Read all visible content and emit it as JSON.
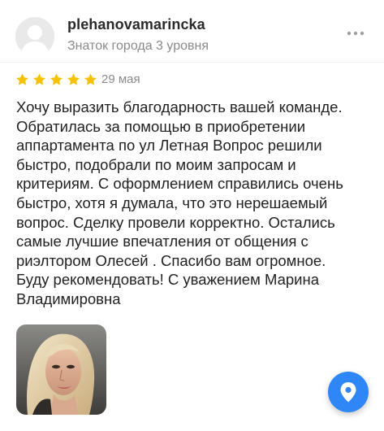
{
  "user": {
    "name": "plehanovamarincka",
    "level": "Знаток города 3 уровня",
    "avatar_icon": "user-avatar-placeholder"
  },
  "review": {
    "rating": 5,
    "max_rating": 5,
    "date": "29 мая",
    "text": "Хочу выразить благодарность вашей команде.\nОбратилась за помощью в приобретении\nаппартамента по ул Летная Вопрос решили\nбыстро, подобрали по моим запросам и\nкритериям. С оформлением справились очень\nбыстро, хотя я думала, что это нерешаемый\nвопрос. Сделку провели корректно. Остались\nсамые лучшие впечатления от общения с\nриэлтором Олесей . Спасибо вам огромное.\nБуду рекомендовать! С уважением Марина\nВладимировна"
  },
  "icons": {
    "more": "more-horizontal-icon",
    "star": "star-icon",
    "map_pin": "map-pin-icon"
  },
  "colors": {
    "star": "#f6c200",
    "fab": "#2f86f6",
    "secondary_text": "#8a8a8a",
    "avatar_bg": "#e9e9ea"
  }
}
